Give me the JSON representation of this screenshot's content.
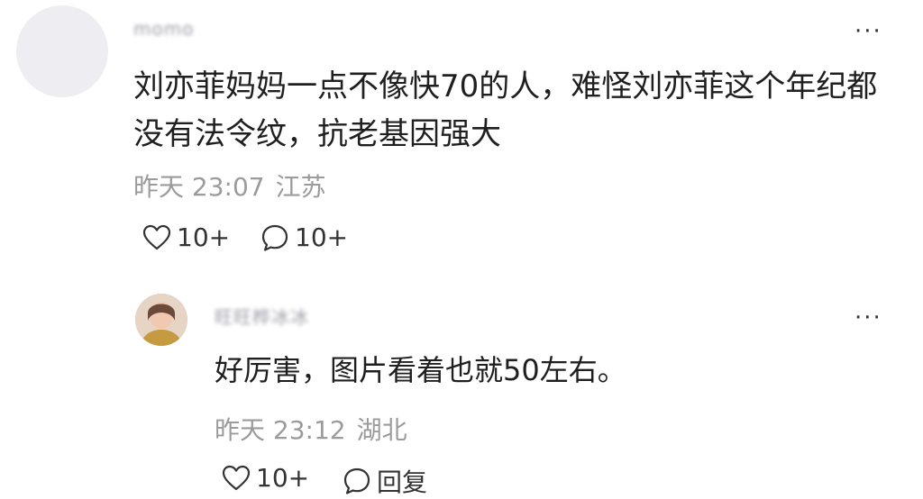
{
  "comment": {
    "username": "momo",
    "text_line1": "刘亦菲妈妈一点不像快70的人，难怪刘亦菲这个年纪都",
    "text_line2": "没有法令纹，抗老基因强大",
    "time": "昨天 23:07",
    "location": "江苏",
    "like_count": "10+",
    "reply_count": "10+"
  },
  "reply": {
    "username": "旺旺桦冰冰",
    "text": "好厉害，图片看着也就50左右。",
    "time": "昨天 23:12",
    "location": "湖北",
    "like_count": "10+",
    "reply_label": "回复"
  },
  "more_glyph": "···",
  "icons": {
    "like": "heart-outline-icon",
    "comment": "speech-bubble-icon",
    "more": "more-dots-icon"
  },
  "colors": {
    "text": "#1f1f1f",
    "meta": "#9b9b9b",
    "avatar_placeholder": "#eeeef2"
  }
}
